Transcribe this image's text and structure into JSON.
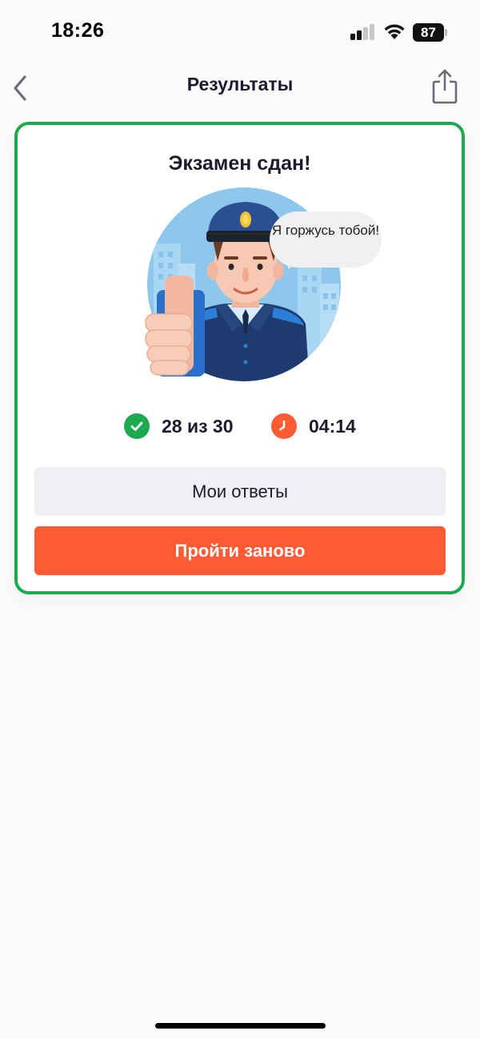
{
  "status_bar": {
    "time": "18:26",
    "battery": "87"
  },
  "nav": {
    "title": "Результаты"
  },
  "card": {
    "title": "Экзамен сдан!",
    "speech": "Я горжусь тобой!",
    "score": "28 из 30",
    "time": "04:14",
    "my_answers_label": "Мои ответы",
    "retry_label": "Пройти заново"
  },
  "colors": {
    "accent_green": "#1daa4e",
    "accent_orange": "#fe5a33",
    "secondary_button": "#efeff4"
  },
  "icons": {
    "back": "chevron-left-icon",
    "share": "share-icon",
    "score": "check-circle-icon",
    "time": "clock-icon"
  }
}
